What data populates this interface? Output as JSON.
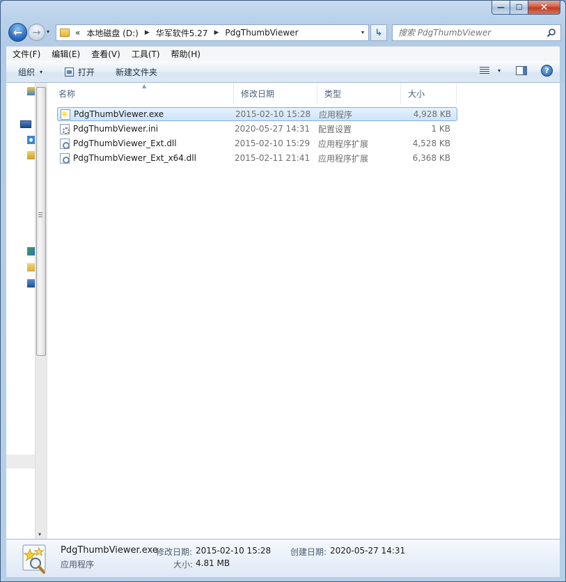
{
  "window": {
    "caption": {
      "minimize": "—",
      "maximize": "☐",
      "close": "✕"
    }
  },
  "nav": {
    "back_glyph": "←",
    "forward_glyph": "→",
    "dropdown_glyph": "▾",
    "breadcrumb": [
      "本地磁盘 (D:)",
      "华军软件5.27",
      "PdgThumbViewer"
    ],
    "overflow": "«",
    "separator": "▶",
    "refresh_glyph": "↳",
    "search_placeholder": "搜索 PdgThumbViewer"
  },
  "menubar": {
    "items": [
      "文件(F)",
      "编辑(E)",
      "查看(V)",
      "工具(T)",
      "帮助(H)"
    ]
  },
  "toolbar": {
    "organize": "组织",
    "open": "打开",
    "new_folder": "新建文件夹",
    "help": "?"
  },
  "columns": [
    "名称",
    "修改日期",
    "类型",
    "大小"
  ],
  "files": [
    {
      "name": "PdgThumbViewer.exe",
      "date": "2015-02-10 15:28",
      "type": "应用程序",
      "size": "4,928 KB",
      "icon": "exe",
      "selected": true
    },
    {
      "name": "PdgThumbViewer.ini",
      "date": "2020-05-27 14:31",
      "type": "配置设置",
      "size": "1 KB",
      "icon": "ini",
      "selected": false
    },
    {
      "name": "PdgThumbViewer_Ext.dll",
      "date": "2015-02-10 15:29",
      "type": "应用程序扩展",
      "size": "4,528 KB",
      "icon": "dll",
      "selected": false
    },
    {
      "name": "PdgThumbViewer_Ext_x64.dll",
      "date": "2015-02-11 21:41",
      "type": "应用程序扩展",
      "size": "6,368 KB",
      "icon": "dll",
      "selected": false
    }
  ],
  "details": {
    "name": "PdgThumbViewer.exe",
    "type": "应用程序",
    "modified_label": "修改日期:",
    "modified_value": "2015-02-10 15:28",
    "created_label": "创建日期:",
    "created_value": "2020-05-27 14:31",
    "size_label": "大小:",
    "size_value": "4.81 MB"
  },
  "colors": {
    "selection": "#cde4fa",
    "accent": "#2d6ec4"
  }
}
